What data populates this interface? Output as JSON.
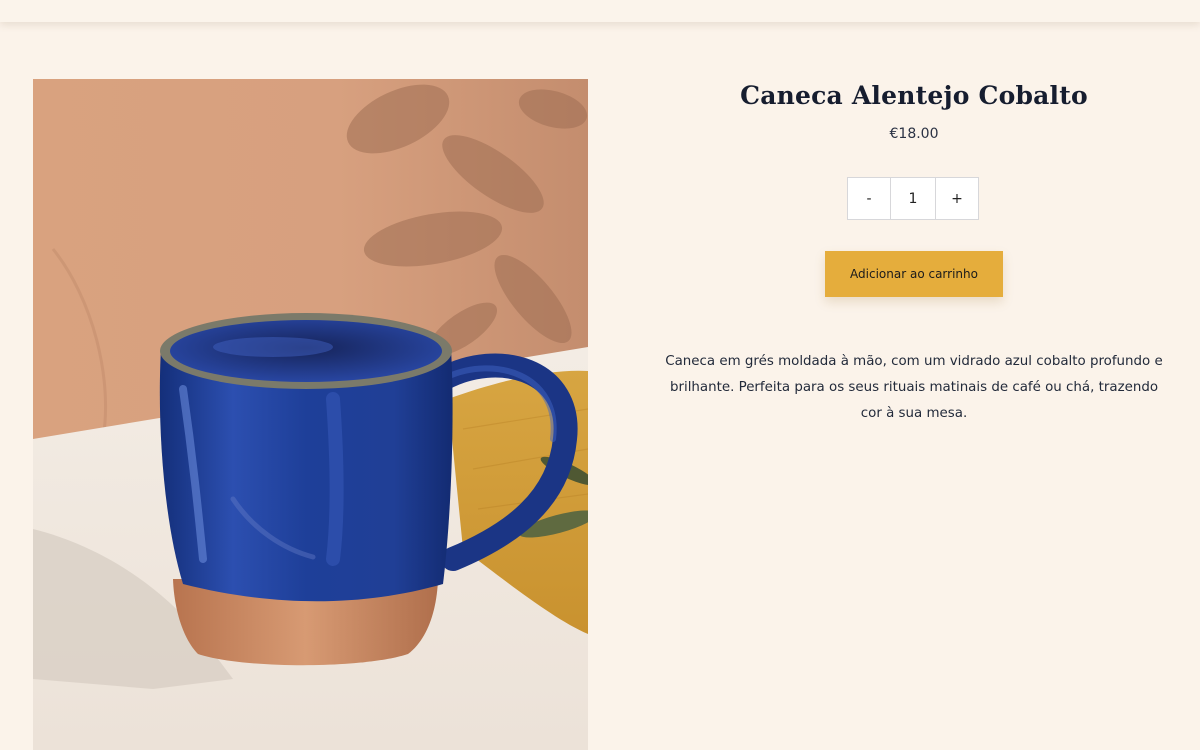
{
  "product": {
    "title": "Caneca Alentejo Cobalto",
    "price": "€18.00",
    "quantity": "1",
    "quantity_minus": "-",
    "quantity_plus": "+",
    "add_to_cart_label": "Adicionar ao carrinho",
    "description": "Caneca em grés moldada à mão, com um vidrado azul cobalto profundo e brilhante. Perfeita para os seus rituais matinais de café ou chá, trazendo cor à sua mesa."
  },
  "colors": {
    "background": "#fbf3ea",
    "accent": "#e5ad3c",
    "mug_glaze": "#1e3f99"
  }
}
